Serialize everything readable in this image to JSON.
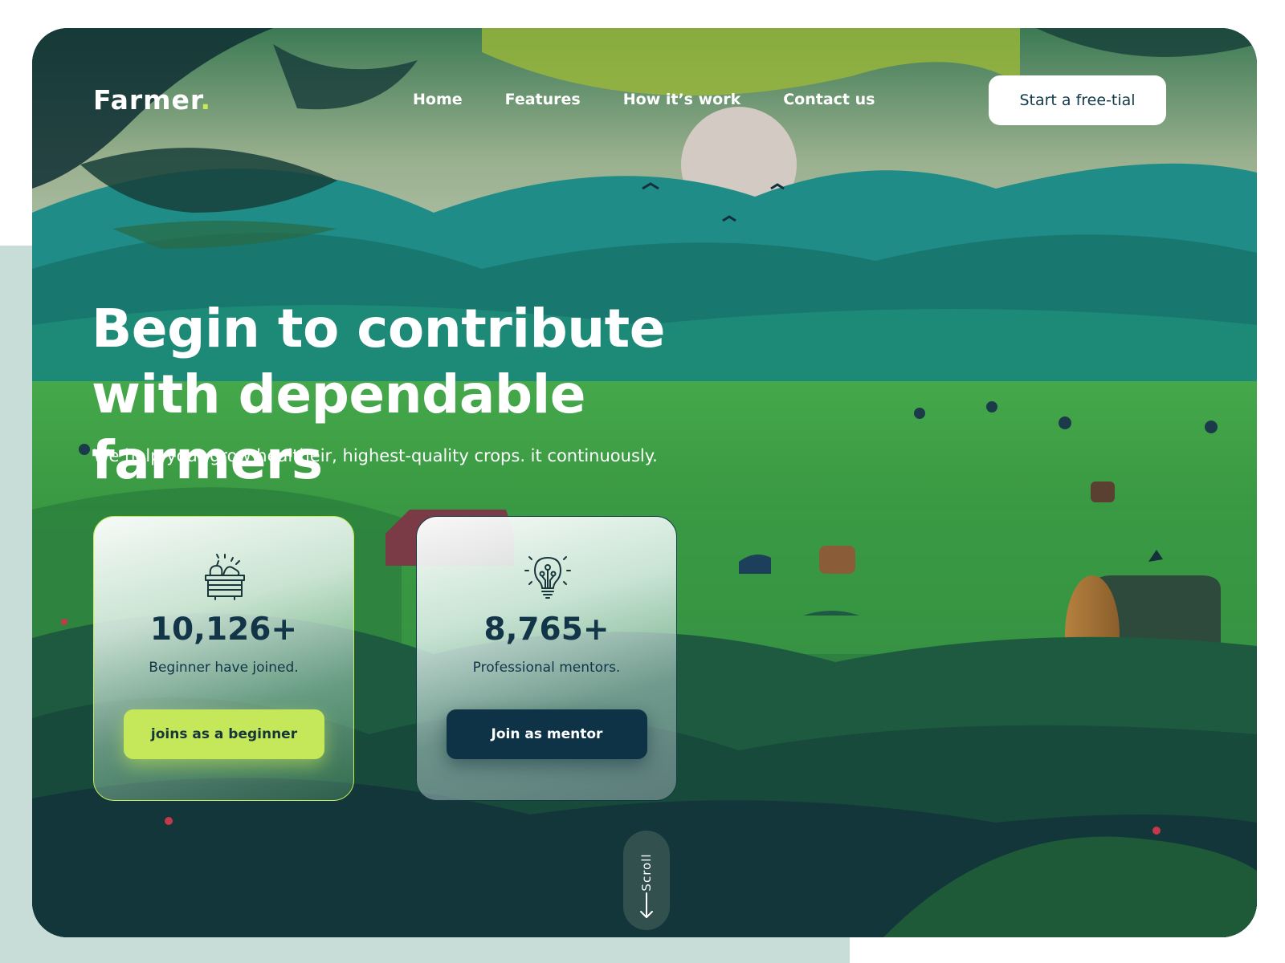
{
  "brand": {
    "name": "Farmer",
    "dot": "."
  },
  "nav": {
    "items": [
      "Home",
      "Features",
      "How it’s work",
      "Contact us"
    ]
  },
  "header": {
    "cta_label": "Start a free-tial"
  },
  "hero": {
    "headline_line1": "Begin to contribute",
    "headline_line2": "with dependable farmers",
    "subheadline": "We help your grow healtheir, highest-quality crops. it continuously."
  },
  "cards": [
    {
      "icon": "basket-icon",
      "value": "10,126+",
      "label": "Beginner have joined.",
      "button": "joins as a beginner"
    },
    {
      "icon": "lightbulb-icon",
      "value": "8,765+",
      "label": "Professional mentors.",
      "button": "Join as mentor"
    }
  ],
  "scroll": {
    "label": "Scroll",
    "icon": "arrow-down-icon"
  },
  "colors": {
    "accent_lime": "#c4e85a",
    "dark_navy": "#0f3346",
    "page_panel": "#c8dcd8",
    "text_white": "#ffffff"
  }
}
